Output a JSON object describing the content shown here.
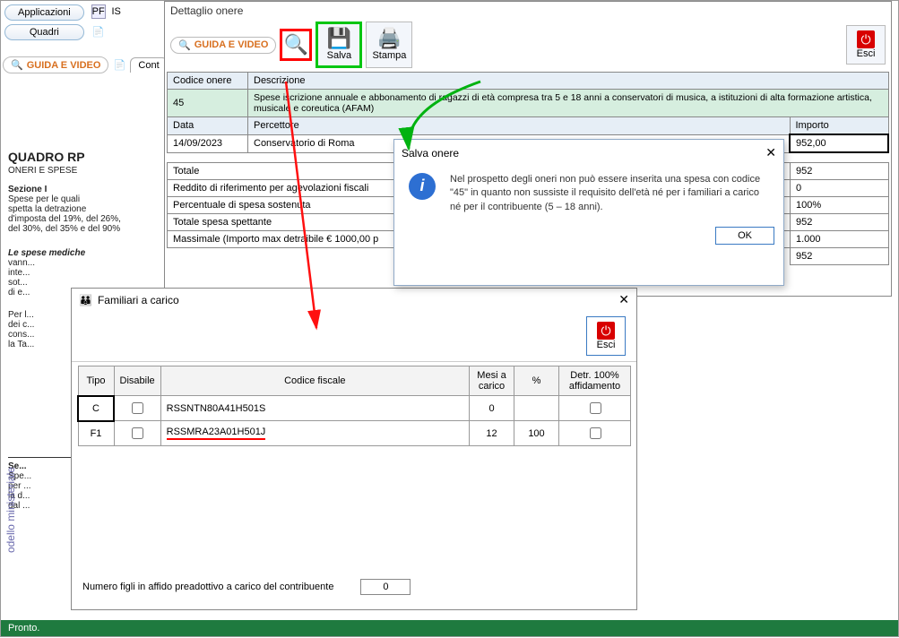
{
  "top": {
    "applicazioni": "Applicazioni",
    "quadri": "Quadri",
    "pf": "PF",
    "is": "IS",
    "guida_video": "GUIDA E VIDEO",
    "cont_tab": "Cont"
  },
  "side": {
    "quadro_title": "QUADRO RP",
    "quadro_sub": "ONERI E SPESE",
    "sezione": "Sezione I",
    "sez_desc1": "Spese per le quali",
    "sez_desc2": "spetta la detrazione",
    "sez_desc3": "d'imposta del 19%, del 26%,",
    "sez_desc4": "del 30%, del 35% e del 90%",
    "note1": "Le spese mediche",
    "note2": "vann...",
    "note3": "inte...",
    "note4": "sot...",
    "note5": "di e...",
    "per": "Per l...",
    "per2": "dei c...",
    "per3": "cons...",
    "per4": "la Ta...",
    "sez2": "Se...",
    "sez2a": "Spe...",
    "sez2b": "per ...",
    "sez2c": "la d...",
    "sez2d": "dal ...",
    "vertical": "odello ministeriale"
  },
  "detail": {
    "title": "Dettaglio onere",
    "salva": "Salva",
    "stampa": "Stampa",
    "esci": "Esci",
    "headers": {
      "codice": "Codice onere",
      "descrizione": "Descrizione",
      "data": "Data",
      "percettore": "Percettore",
      "importo": "Importo"
    },
    "row": {
      "codice": "45",
      "descrizione": "Spese iscrizione annuale e abbonamento di ragazzi di età compresa tra 5 e 18 anni a conservatori di musica, a istituzioni di alta formazione artistica, musicale e coreutica (AFAM)",
      "data": "14/09/2023",
      "percettore": "Conservatorio di Roma",
      "importo": "952,00"
    },
    "totals": {
      "totale_lbl": "Totale",
      "totale_val": "952",
      "reddito_lbl": "Reddito di riferimento per agevolazioni fiscali",
      "reddito_val": "0",
      "perc_lbl": "Percentuale di spesa sostenuta",
      "perc_val": "100%",
      "spettante_lbl": "Totale spesa spettante",
      "spettante_val": "952",
      "max_lbl": "Massimale (Importo max detraibile € 1000,00 p",
      "max_val": "1.000",
      "last_val": "952"
    }
  },
  "modal": {
    "title": "Salva onere",
    "message": "Nel prospetto degli oneri non può essere inserita una spesa con codice \"45\" in quanto non sussiste il requisito dell'età né per i familiari a carico né per il contribuente (5 – 18 anni).",
    "ok": "OK"
  },
  "fam": {
    "title": "Familiari a carico",
    "esci": "Esci",
    "cols": {
      "tipo": "Tipo",
      "disabile": "Disabile",
      "cf": "Codice fiscale",
      "mesi": "Mesi a carico",
      "perc": "%",
      "detr": "Detr. 100% affidamento"
    },
    "rows": [
      {
        "tipo": "C",
        "disabile": "",
        "cf": "RSSNTN80A41H501S",
        "mesi": "0",
        "perc": "",
        "detr": ""
      },
      {
        "tipo": "F1",
        "disabile": "",
        "cf": "RSSMRA23A01H501J",
        "mesi": "12",
        "perc": "100",
        "detr": ""
      }
    ],
    "bottom_label": "Numero figli in affido preadottivo a carico del contribuente",
    "bottom_val": "0"
  },
  "status": "Pronto."
}
